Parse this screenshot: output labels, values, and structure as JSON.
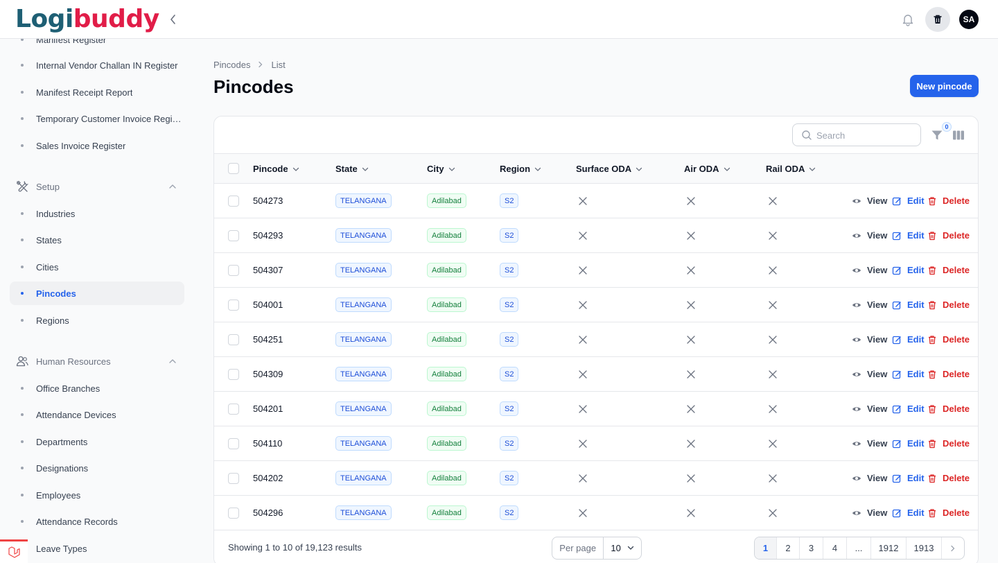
{
  "brand": {
    "name_part1": "Logi",
    "name_part2": "buddy"
  },
  "topbar": {
    "avatar_initials": "SA"
  },
  "sidebar": {
    "reports_items": [
      {
        "label": "Manifest Register"
      },
      {
        "label": "Internal Vendor Challan IN Register"
      },
      {
        "label": "Manifest Receipt Report"
      },
      {
        "label": "Temporary Customer Invoice Register"
      },
      {
        "label": "Sales Invoice Register"
      }
    ],
    "setup": {
      "label": "Setup",
      "items": [
        {
          "label": "Industries"
        },
        {
          "label": "States"
        },
        {
          "label": "Cities"
        },
        {
          "label": "Pincodes"
        },
        {
          "label": "Regions"
        }
      ]
    },
    "hr": {
      "label": "Human Resources",
      "items": [
        {
          "label": "Office Branches"
        },
        {
          "label": "Attendance Devices"
        },
        {
          "label": "Departments"
        },
        {
          "label": "Designations"
        },
        {
          "label": "Employees"
        },
        {
          "label": "Attendance Records"
        },
        {
          "label": "Leave Types"
        }
      ]
    }
  },
  "breadcrumb": {
    "parent": "Pincodes",
    "current": "List"
  },
  "page": {
    "title": "Pincodes",
    "new_button": "New pincode"
  },
  "toolbar": {
    "search_placeholder": "Search",
    "filter_count": "0"
  },
  "table": {
    "columns": [
      "Pincode",
      "State",
      "City",
      "Region",
      "Surface ODA",
      "Air ODA",
      "Rail ODA"
    ],
    "actions": {
      "view": "View",
      "edit": "Edit",
      "delete": "Delete"
    },
    "rows": [
      {
        "pincode": "504273",
        "state": "TELANGANA",
        "city": "Adilabad",
        "region": "S2"
      },
      {
        "pincode": "504293",
        "state": "TELANGANA",
        "city": "Adilabad",
        "region": "S2"
      },
      {
        "pincode": "504307",
        "state": "TELANGANA",
        "city": "Adilabad",
        "region": "S2"
      },
      {
        "pincode": "504001",
        "state": "TELANGANA",
        "city": "Adilabad",
        "region": "S2"
      },
      {
        "pincode": "504251",
        "state": "TELANGANA",
        "city": "Adilabad",
        "region": "S2"
      },
      {
        "pincode": "504309",
        "state": "TELANGANA",
        "city": "Adilabad",
        "region": "S2"
      },
      {
        "pincode": "504201",
        "state": "TELANGANA",
        "city": "Adilabad",
        "region": "S2"
      },
      {
        "pincode": "504110",
        "state": "TELANGANA",
        "city": "Adilabad",
        "region": "S2"
      },
      {
        "pincode": "504202",
        "state": "TELANGANA",
        "city": "Adilabad",
        "region": "S2"
      },
      {
        "pincode": "504296",
        "state": "TELANGANA",
        "city": "Adilabad",
        "region": "S2"
      }
    ]
  },
  "footer": {
    "showing": "Showing 1 to 10 of 19,123 results",
    "per_page_label": "Per page",
    "per_page_value": "10",
    "pages": [
      "1",
      "2",
      "3",
      "4",
      "...",
      "1912",
      "1913"
    ],
    "current_page": "1"
  },
  "colors": {
    "primary": "#2563eb",
    "danger": "#dc2626",
    "success": "#15803d",
    "brand_teal": "#1e5f74",
    "brand_red": "#e11d48"
  }
}
